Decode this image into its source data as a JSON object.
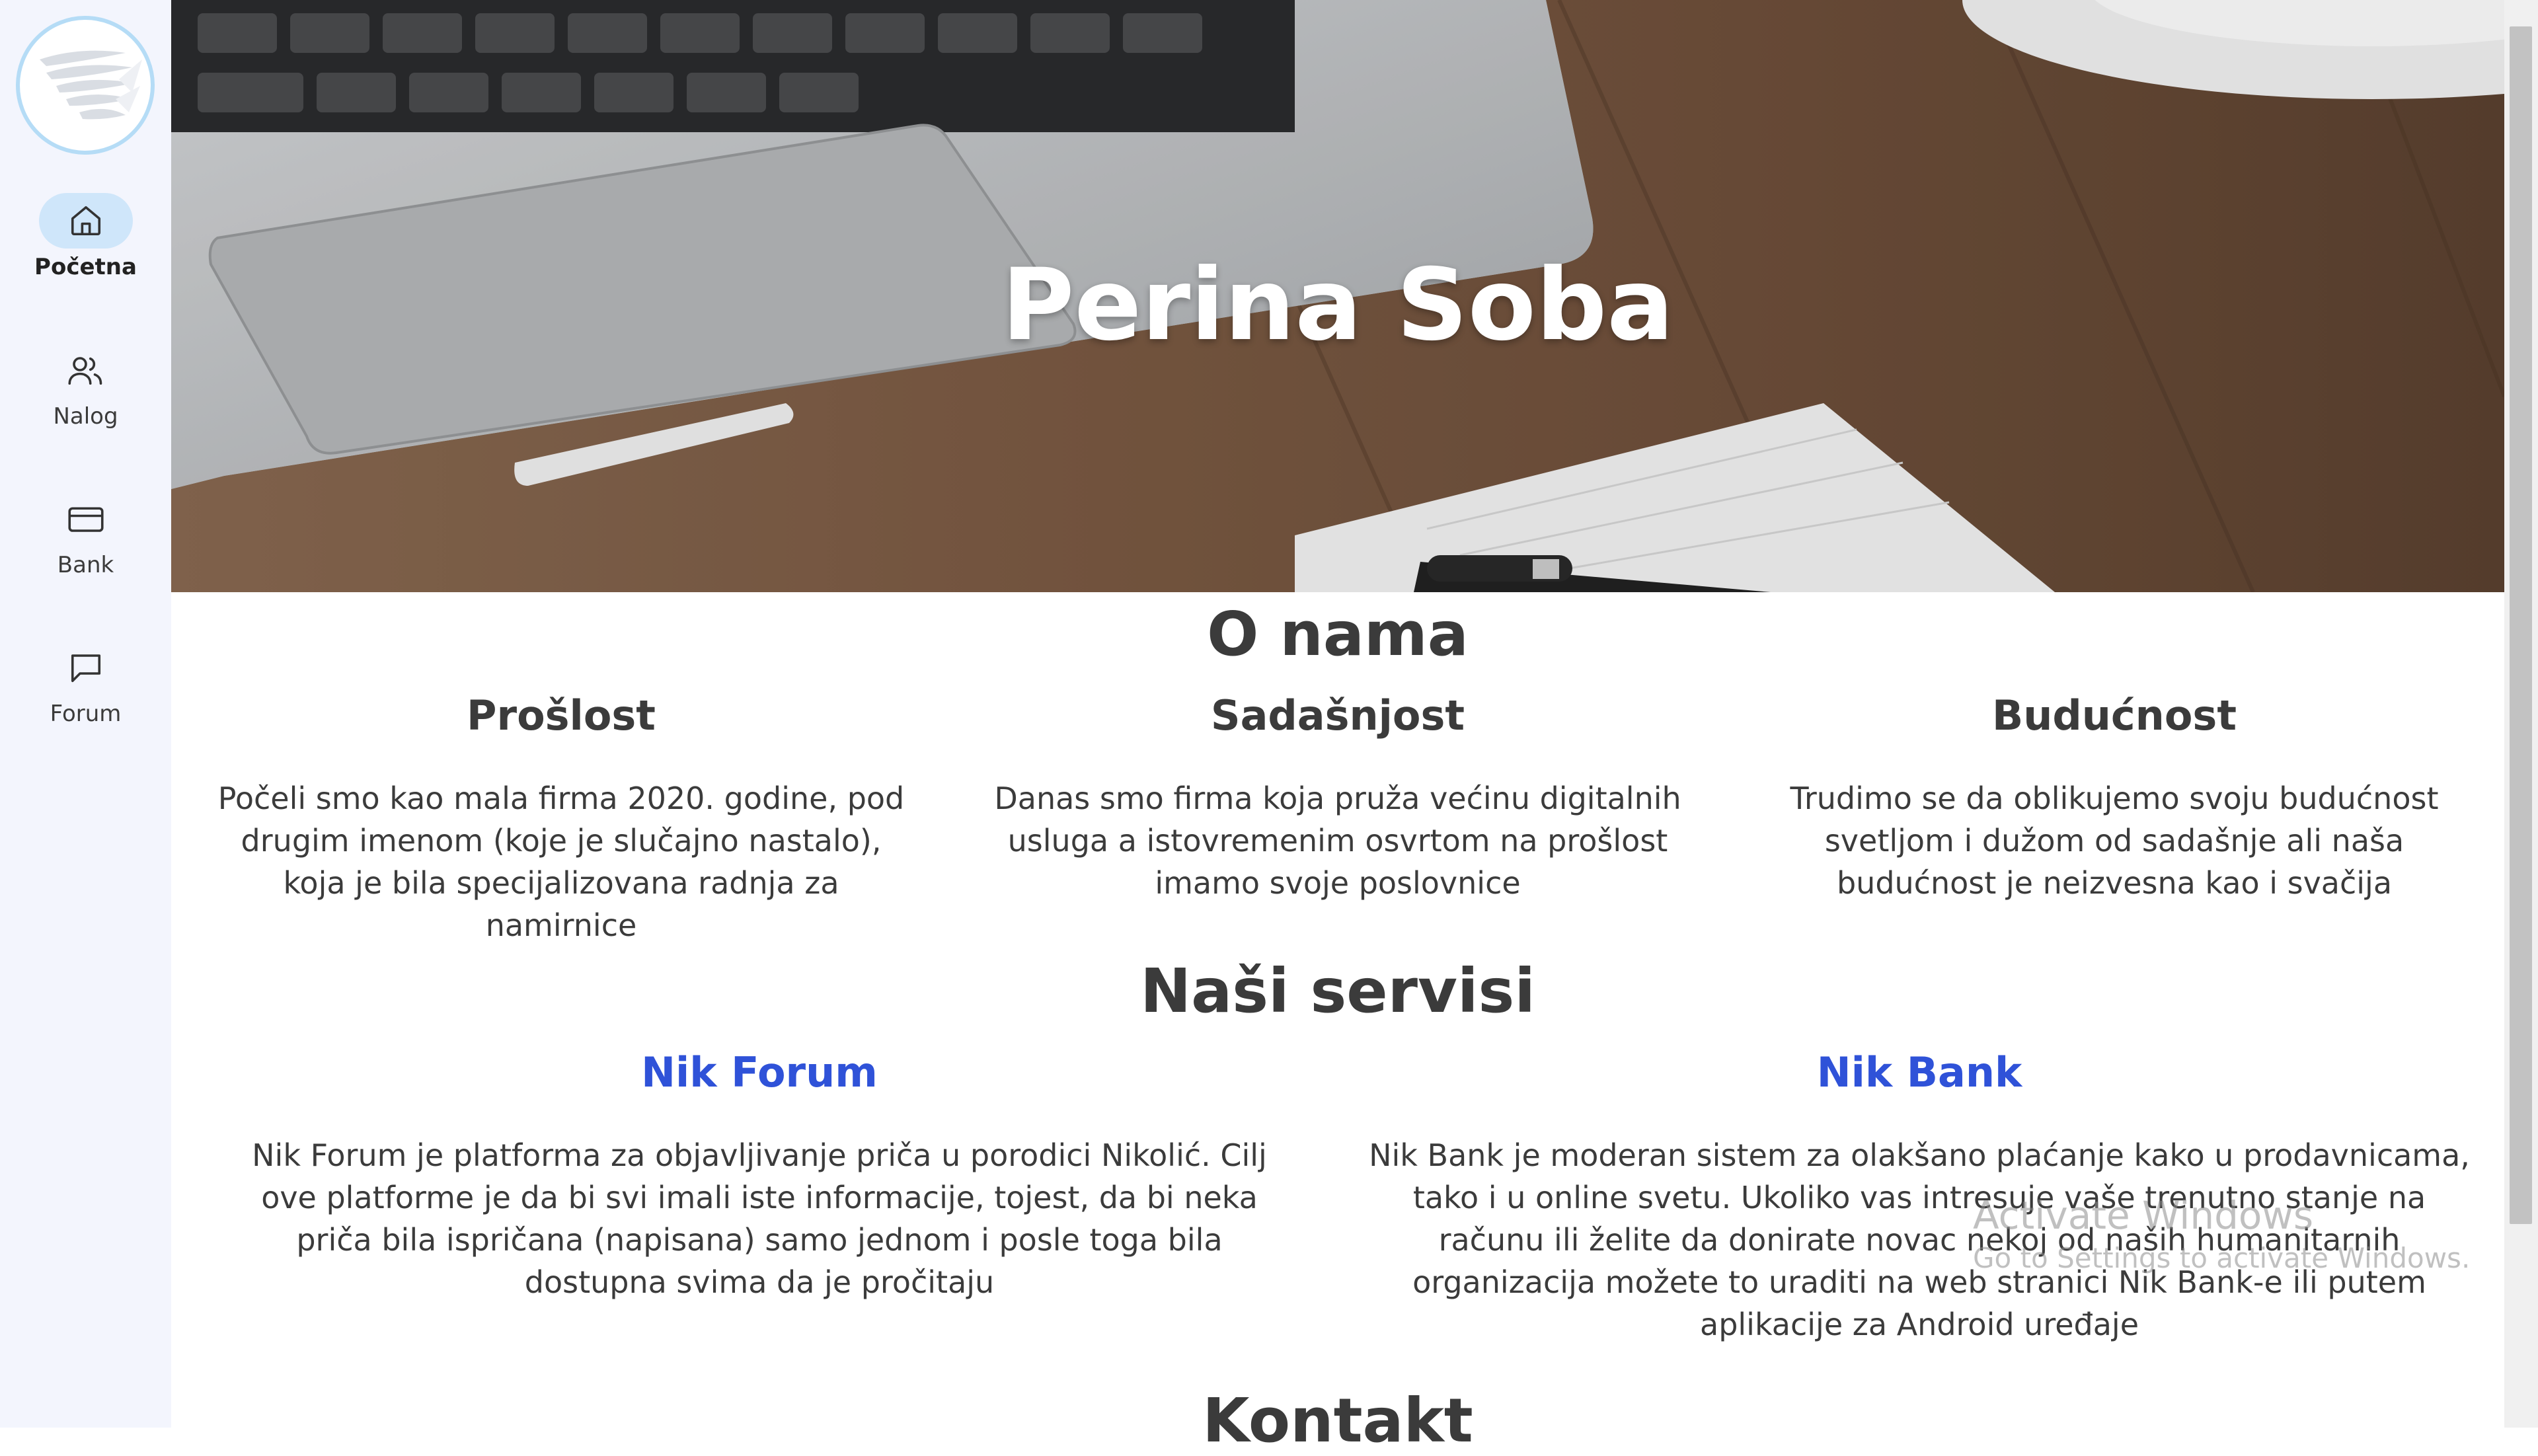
{
  "sidebar": {
    "items": [
      {
        "label": "Početna",
        "icon": "home-icon",
        "active": true
      },
      {
        "label": "Nalog",
        "icon": "users-icon",
        "active": false
      },
      {
        "label": "Bank",
        "icon": "credit-card-icon",
        "active": false
      },
      {
        "label": "Forum",
        "icon": "message-square-icon",
        "active": false
      }
    ]
  },
  "hero": {
    "title": "Perina Soba"
  },
  "about": {
    "title": "O nama",
    "columns": [
      {
        "title": "Prošlost",
        "text": "Počeli smo kao mala firma 2020. godine, pod drugim imenom (koje je slučajno nastalo), koja je bila specijalizovana radnja za namirnice"
      },
      {
        "title": "Sadašnjost",
        "text": "Danas smo firma koja pruža većinu digitalnih usluga a istovremenim osvrtom na prošlost imamo svoje poslovnice"
      },
      {
        "title": "Budućnost",
        "text": "Trudimo se da oblikujemo svoju budućnost svetljom i dužom od sadašnje ali naša budućnost je neizvesna kao i svačija"
      }
    ]
  },
  "services": {
    "title": "Naši servisi",
    "items": [
      {
        "title": "Nik Forum",
        "text": "Nik Forum je platforma za objavljivanje priča u porodici Nikolić. Cilj ove platforme je da bi svi imali iste informacije, tojest, da bi neka priča bila ispričana (napisana) samo jednom i posle toga bila dostupna svima da je pročitaju"
      },
      {
        "title": "Nik Bank",
        "text": "Nik Bank je moderan sistem za olakšano plaćanje kako u prodavnicama, tako i u online svetu. Ukoliko vas intresuje vaše trenutno stanje na računu ili želite da donirate novac nekoj od naših humanitarnih organizacija možete to uraditi na web stranici Nik Bank-e ili putem aplikacije za Android uređaje"
      }
    ]
  },
  "contact": {
    "title": "Kontakt"
  },
  "watermark": {
    "line1": "Activate Windows",
    "line2": "Go to Settings to activate Windows."
  },
  "colors": {
    "accent": "#2f52d8",
    "sidebar_bg": "#f3f5fd",
    "active_pill": "#cfe6fa",
    "logo_ring": "#b5dcf6"
  }
}
